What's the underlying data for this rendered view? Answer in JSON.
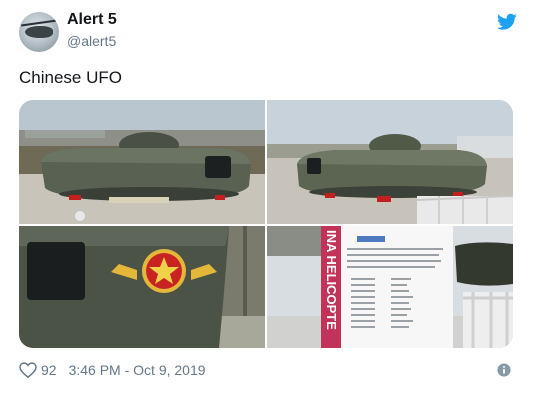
{
  "author": {
    "name": "Alert 5",
    "handle": "@alert5"
  },
  "tweet": {
    "text": "Chinese UFO"
  },
  "photo4": {
    "sign_text": "INA HELICOPTE"
  },
  "footer": {
    "likes": "92",
    "timestamp": "3:46 PM - Oct 9, 2019"
  }
}
